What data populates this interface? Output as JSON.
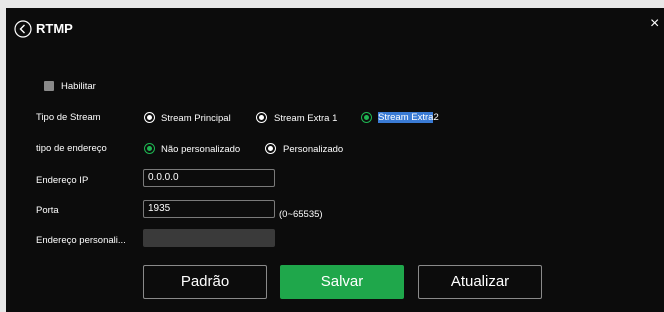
{
  "header": {
    "title": "RTMP",
    "close_glyph": "×"
  },
  "enable": {
    "label": "Habilitar",
    "checked": false
  },
  "stream_type": {
    "label": "Tipo de Stream",
    "options": [
      {
        "label": "Stream Principal",
        "selected": false
      },
      {
        "label": "Stream Extra 1",
        "selected": false
      },
      {
        "label_selected_part": "Stream Extra",
        "label_rest": "2",
        "selected": true
      }
    ]
  },
  "address_type": {
    "label": "tipo de endereço",
    "options": [
      {
        "label": "Não personalizado",
        "selected": true
      },
      {
        "label": "Personalizado",
        "selected": false
      }
    ]
  },
  "ip": {
    "label": "Endereço IP",
    "value": "0.0.0.0"
  },
  "port": {
    "label": "Porta",
    "value": "1935",
    "range": "(0~65535)"
  },
  "custom_address": {
    "label": "Endereço personali...",
    "value": ""
  },
  "buttons": {
    "default": "Padrão",
    "save": "Salvar",
    "refresh": "Atualizar"
  },
  "colors": {
    "accent_green": "#1fa74b",
    "background": "#0c0c0c",
    "selection": "#3a7bd5"
  }
}
